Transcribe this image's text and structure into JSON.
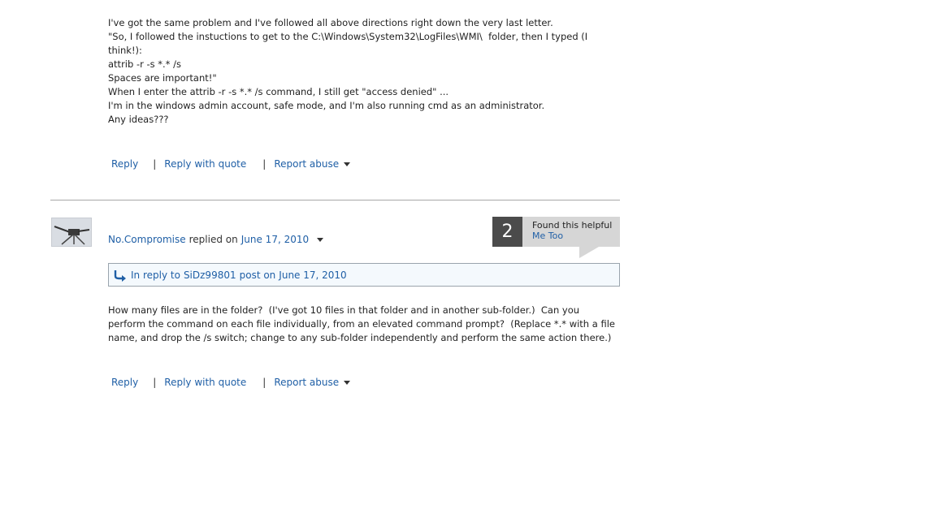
{
  "post1": {
    "lines": [
      "I've got the same problem and I've followed all above directions right down the very last letter.",
      "\"So, I followed the instuctions to get to the C:\\Windows\\System32\\LogFiles\\WMI\\  folder, then I typed (I think!):",
      "attrib -r -s *.* /s",
      "Spaces are important!\"",
      "When I enter the attrib -r -s *.* /s command, I still get \"access denied\" ...",
      "I'm in the windows admin account, safe mode, and I'm also running cmd as an administrator.",
      "Any ideas???"
    ],
    "actions": {
      "reply": "Reply",
      "separator": "|",
      "reply_with_quote": "Reply with quote",
      "report_abuse": "Report abuse"
    }
  },
  "post2": {
    "author": "No.Compromise",
    "replied_on_text": "replied on",
    "date": "June 17, 2010",
    "helpful": {
      "count": "2",
      "label": "Found this helpful",
      "me_too": "Me Too"
    },
    "reply_to": {
      "prefix": "In reply to",
      "user": "SiDz99801",
      "post_on": "post on",
      "date": "June 17, 2010"
    },
    "lines": [
      "How many files are in the folder?  (I've got 10 files in that folder and in another sub-folder.)  Can you",
      "perform the command on each file individually, from an elevated command prompt?  (Replace *.* with a file",
      "name, and drop the /s switch; change to any sub-folder independently and perform the same action there.)"
    ],
    "actions": {
      "reply": "Reply",
      "separator": "|",
      "reply_with_quote": "Reply with quote",
      "report_abuse": "Report abuse"
    }
  },
  "colors": {
    "link": "#1f5fa6",
    "helpful_count_bg": "#4b4b4b",
    "helpful_box_bg": "#d6d6d6",
    "reply_to_bg": "#f4f9fd",
    "divider": "#a8a8a8"
  },
  "icons": [
    "avatar-image",
    "chevron-down-icon",
    "reply-arrow-icon"
  ]
}
